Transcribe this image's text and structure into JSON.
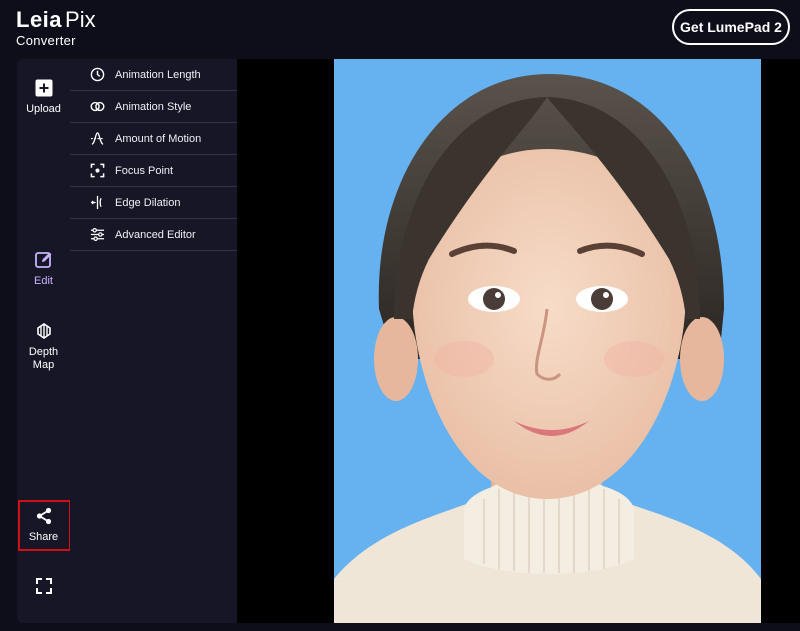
{
  "brand": {
    "name_bold": "Leia",
    "name_light": "Pix",
    "subtitle": "Converter"
  },
  "header": {
    "cta_label": "Get LumePad 2"
  },
  "rail": {
    "upload_label": "Upload",
    "edit_label": "Edit",
    "depth_map_label": "Depth Map",
    "share_label": "Share"
  },
  "edit_menu": [
    {
      "label": "Animation Length",
      "icon": "clock-icon"
    },
    {
      "label": "Animation Style",
      "icon": "style-rings-icon"
    },
    {
      "label": "Amount of Motion",
      "icon": "motion-icon"
    },
    {
      "label": "Focus Point",
      "icon": "focus-icon"
    },
    {
      "label": "Edge Dilation",
      "icon": "edge-dilation-icon"
    },
    {
      "label": "Advanced Editor",
      "icon": "sliders-icon"
    }
  ],
  "colors": {
    "background": "#0e0e1a",
    "panel": "#161626",
    "accent": "#c9b3ff",
    "highlight_box": "#d10f14",
    "photo_bg": "#66b1ef"
  }
}
